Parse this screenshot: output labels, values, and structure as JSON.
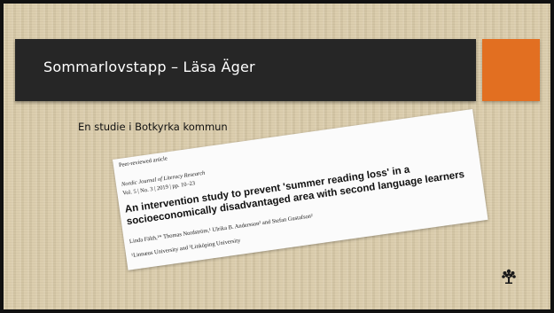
{
  "slide": {
    "title": "Sommarlovstapp – Läsa Äger",
    "subtitle": "En studie i Botkyrka kommun"
  },
  "article": {
    "tag": "Peer-reviewed article",
    "journal": "Nordic Journal of Literacy Research",
    "volume": "Vol. 5 | No. 3 | 2019 | pp. 10–23",
    "title_line1": "An intervention study to prevent 'summer reading loss' in a",
    "title_line2": "socioeconomically disadvantaged area with second language learners",
    "authors": "Linda Fälth,¹* Thomas Nordström,¹ Ulrika B. Andersson² and Stefan Gustafson²",
    "affiliations": "¹Linnæus University and ²Linköping University"
  },
  "colors": {
    "title_bar": "#262626",
    "accent": "#e26f21",
    "background": "#d8c9a7"
  },
  "icons": {
    "logo": "tree-icon"
  }
}
